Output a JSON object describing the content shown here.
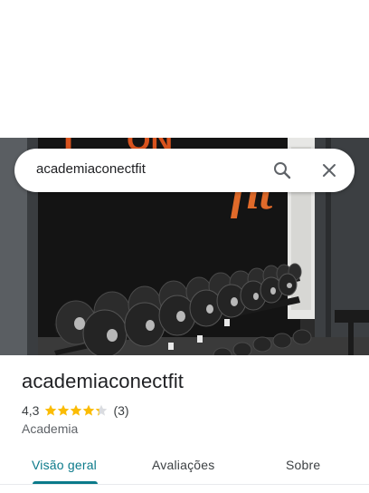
{
  "search": {
    "query": "academiaconectfit",
    "search_icon": "search-icon",
    "close_icon": "close-icon"
  },
  "place": {
    "name": "academiaconectfit",
    "rating": "4,3",
    "rating_stars": 4.3,
    "review_count": "(3)",
    "category": "Academia"
  },
  "tabs": [
    {
      "label": "Visão geral",
      "active": true
    },
    {
      "label": "Avaliações",
      "active": false
    },
    {
      "label": "Sobre",
      "active": false
    }
  ],
  "colors": {
    "accent": "#0b7a8a",
    "star": "#fbbc04",
    "star_empty": "#dadce0"
  }
}
